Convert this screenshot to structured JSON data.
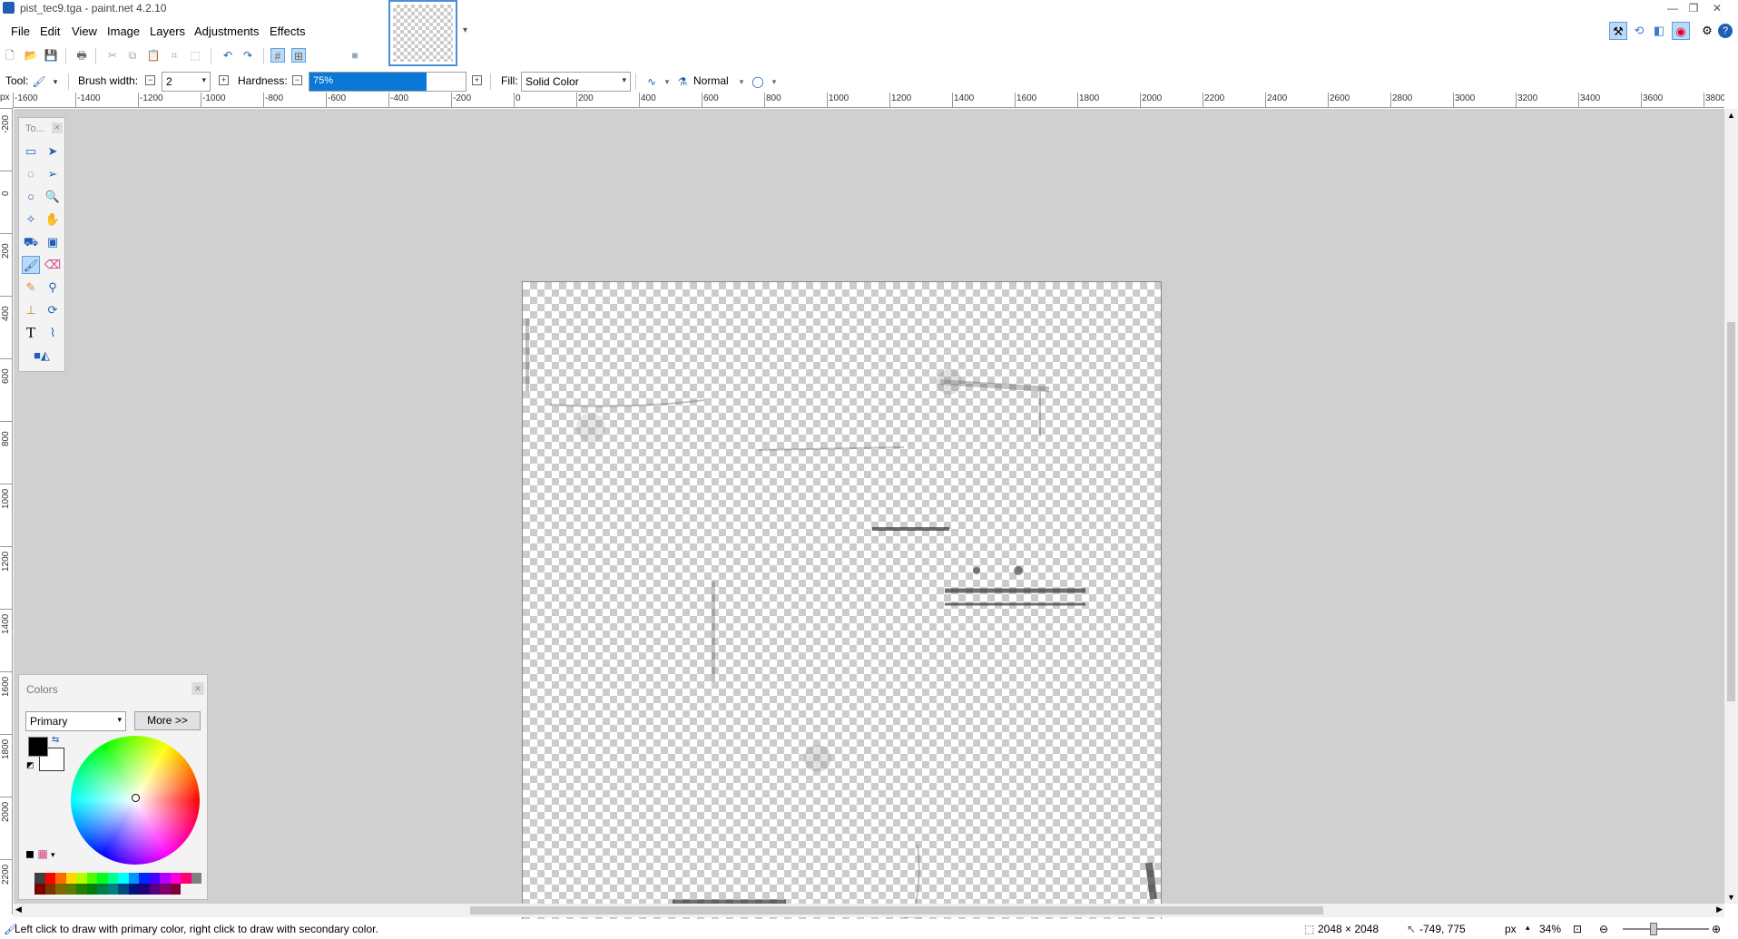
{
  "window": {
    "title": "pist_tec9.tga - paint.net 4.2.10",
    "minimize": "—",
    "restore": "❐",
    "close": "✕"
  },
  "menu": [
    "File",
    "Edit",
    "View",
    "Image",
    "Layers",
    "Adjustments",
    "Effects"
  ],
  "tool_options": {
    "tool_label": "Tool:",
    "brush_width_label": "Brush width:",
    "brush_width_value": "2",
    "hardness_label": "Hardness:",
    "hardness_value": "75%",
    "hardness_fraction": 0.75,
    "fill_label": "Fill:",
    "fill_value": "Solid Color",
    "blend_mode": "Normal"
  },
  "ruler": {
    "unit": "px",
    "h_labels": [
      "1600",
      "1400",
      "1200",
      "1000",
      "800",
      "600",
      "400",
      "200",
      "0",
      "200",
      "400",
      "600",
      "800",
      "1000",
      "1200",
      "1400",
      "1600",
      "1800",
      "2000",
      "2200",
      "2400",
      "2600",
      "2800",
      "3000",
      "3200",
      "3400",
      "3600",
      "3800"
    ],
    "v_labels": [
      "200",
      "0",
      "200",
      "400",
      "600",
      "800",
      "1000",
      "1200",
      "1400",
      "1600",
      "1800",
      "2000",
      "2200"
    ]
  },
  "tools_window": {
    "title": "To..."
  },
  "colors_window": {
    "title": "Colors",
    "mode": "Primary",
    "more_button": "More >>",
    "primary_color": "#000000",
    "secondary_color": "#ffffff"
  },
  "palette": [
    "#404040",
    "#ff0000",
    "#ff6a00",
    "#ffd800",
    "#b6ff00",
    "#4cff00",
    "#00ff21",
    "#00ff90",
    "#00ffff",
    "#0094ff",
    "#0026ff",
    "#4800ff",
    "#b200ff",
    "#ff00dc",
    "#ff006e",
    "#808080",
    "#7f0000",
    "#7f3300",
    "#7f6a00",
    "#5b7f00",
    "#267f00",
    "#007f0e",
    "#007f46",
    "#007f7f",
    "#004a7f",
    "#00137f",
    "#21007f",
    "#57007f",
    "#7f006e",
    "#7f0037"
  ],
  "status": {
    "hint": "Left click to draw with primary color, right click to draw with secondary color.",
    "image_size": "2048 × 2048",
    "cursor_pos": "-749, 775",
    "unit": "px",
    "zoom": "34%"
  }
}
